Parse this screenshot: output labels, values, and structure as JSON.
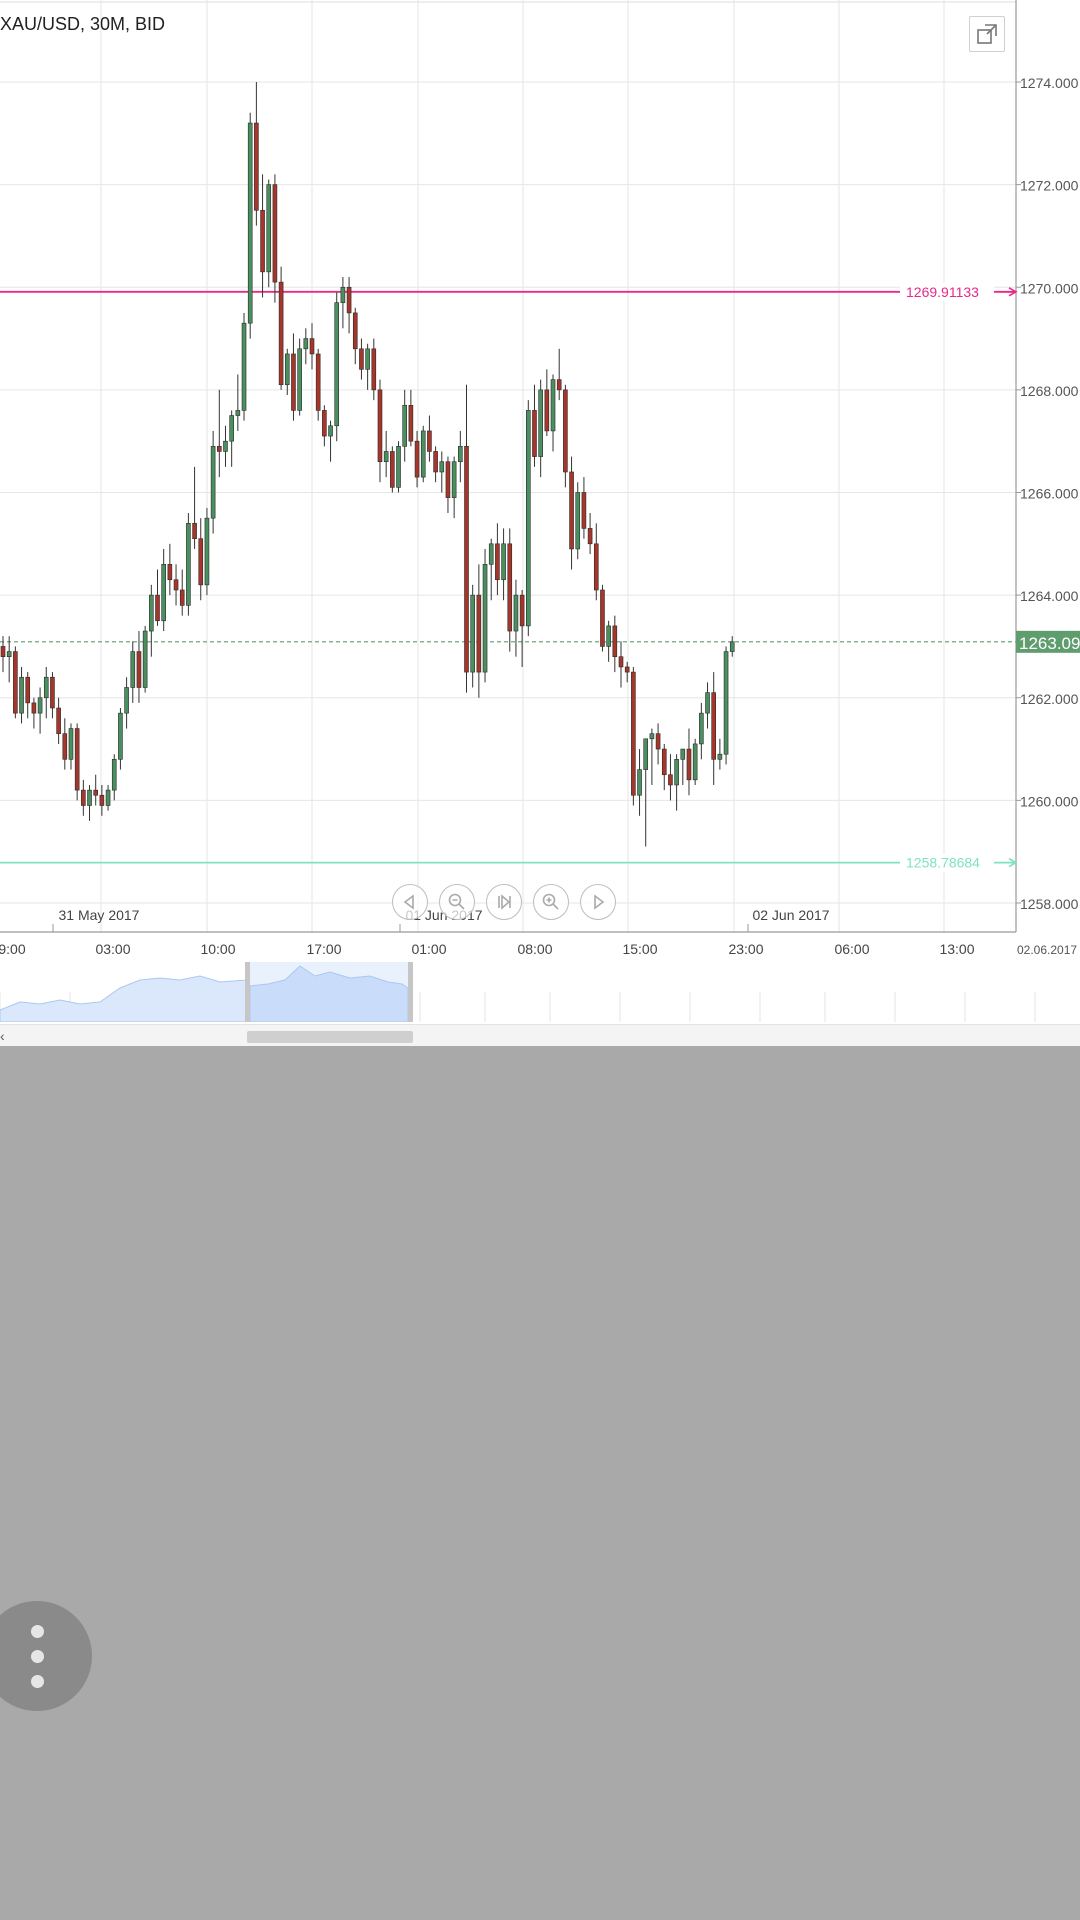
{
  "chart": {
    "title": "XAU/USD, 30M, BID",
    "expand_icon": "expand-icon"
  },
  "nav_controls": [
    {
      "name": "pan-left-button",
      "icon": "triangle-left-icon"
    },
    {
      "name": "zoom-out-button",
      "icon": "zoom-out-icon"
    },
    {
      "name": "go-to-latest-button",
      "icon": "skip-end-icon"
    },
    {
      "name": "zoom-in-button",
      "icon": "zoom-in-icon"
    },
    {
      "name": "pan-right-button",
      "icon": "triangle-right-icon"
    }
  ],
  "fab": {
    "icon": "more-vertical-icon"
  },
  "colors": {
    "bull": "#4a8f5f",
    "bear": "#a6352b",
    "resistance": "#e8298a",
    "support": "#7fe3bd",
    "current_price": "#5f9c6e",
    "grid": "#e6e6e6",
    "navigator_fill": "#dbe8fb",
    "navigator_line": "#aac8f2"
  },
  "chart_data": {
    "type": "candlestick",
    "title": "XAU/USD, 30M, BID",
    "ylim": [
      1257.5,
      1275.2
    ],
    "y_ticks": [
      "1274.000",
      "1272.000",
      "1270.000",
      "1268.000",
      "1266.000",
      "1264.000",
      "1262.000",
      "1260.000",
      "1258.000"
    ],
    "y_tick_values": [
      1274,
      1272,
      1270,
      1268,
      1266,
      1264,
      1262,
      1260,
      1258
    ],
    "x_time_labels": [
      "9:00",
      "03:00",
      "10:00",
      "17:00",
      "01:00",
      "08:00",
      "15:00",
      "23:00",
      "06:00",
      "13:00"
    ],
    "x_date_labels": [
      "31 May 2017",
      "01 Jun 2017",
      "02 Jun 2017"
    ],
    "corner_date": "02.06.2017",
    "resistance_label": "1269.91133",
    "resistance_value": 1269.91133,
    "support_label": "1258.78684",
    "support_value": 1258.78684,
    "current_label": "1263.09",
    "current_value": 1263.09,
    "candles": [
      [
        1263.0,
        1263.2,
        1262.5,
        1262.8
      ],
      [
        1262.8,
        1263.2,
        1262.3,
        1262.9
      ],
      [
        1262.9,
        1263.0,
        1261.6,
        1261.7
      ],
      [
        1261.7,
        1262.6,
        1261.5,
        1262.4
      ],
      [
        1262.4,
        1262.5,
        1261.6,
        1261.9
      ],
      [
        1261.9,
        1262.0,
        1261.4,
        1261.7
      ],
      [
        1261.7,
        1262.2,
        1261.3,
        1262.0
      ],
      [
        1262.0,
        1262.6,
        1261.6,
        1262.4
      ],
      [
        1262.4,
        1262.5,
        1261.6,
        1261.8
      ],
      [
        1261.8,
        1262.0,
        1261.1,
        1261.3
      ],
      [
        1261.3,
        1261.6,
        1260.6,
        1260.8
      ],
      [
        1260.8,
        1261.5,
        1260.6,
        1261.4
      ],
      [
        1261.4,
        1261.5,
        1260.0,
        1260.2
      ],
      [
        1260.2,
        1260.4,
        1259.7,
        1259.9
      ],
      [
        1259.9,
        1260.3,
        1259.6,
        1260.2
      ],
      [
        1260.2,
        1260.5,
        1259.9,
        1260.1
      ],
      [
        1260.1,
        1260.3,
        1259.7,
        1259.9
      ],
      [
        1259.9,
        1260.3,
        1259.8,
        1260.2
      ],
      [
        1260.2,
        1260.9,
        1260.0,
        1260.8
      ],
      [
        1260.8,
        1261.8,
        1260.6,
        1261.7
      ],
      [
        1261.7,
        1262.4,
        1261.4,
        1262.2
      ],
      [
        1262.2,
        1263.1,
        1261.9,
        1262.9
      ],
      [
        1262.9,
        1263.3,
        1261.9,
        1262.2
      ],
      [
        1262.2,
        1263.4,
        1262.1,
        1263.3
      ],
      [
        1263.3,
        1264.2,
        1262.8,
        1264.0
      ],
      [
        1264.0,
        1264.5,
        1263.4,
        1263.5
      ],
      [
        1263.5,
        1264.9,
        1263.3,
        1264.6
      ],
      [
        1264.6,
        1265.0,
        1264.0,
        1264.3
      ],
      [
        1264.3,
        1264.6,
        1263.8,
        1264.1
      ],
      [
        1264.1,
        1264.5,
        1263.6,
        1263.8
      ],
      [
        1263.8,
        1265.6,
        1263.6,
        1265.4
      ],
      [
        1265.4,
        1266.5,
        1264.9,
        1265.1
      ],
      [
        1265.1,
        1265.5,
        1263.9,
        1264.2
      ],
      [
        1264.2,
        1265.7,
        1264.0,
        1265.5
      ],
      [
        1265.5,
        1267.2,
        1265.2,
        1266.9
      ],
      [
        1266.9,
        1268.0,
        1266.3,
        1266.8
      ],
      [
        1266.8,
        1267.3,
        1266.5,
        1267.0
      ],
      [
        1267.0,
        1267.6,
        1266.5,
        1267.5
      ],
      [
        1267.5,
        1268.3,
        1267.2,
        1267.6
      ],
      [
        1267.6,
        1269.5,
        1267.4,
        1269.3
      ],
      [
        1269.3,
        1273.4,
        1269.0,
        1273.2
      ],
      [
        1273.2,
        1274.0,
        1271.2,
        1271.5
      ],
      [
        1271.5,
        1272.2,
        1269.8,
        1270.3
      ],
      [
        1270.3,
        1272.1,
        1270.0,
        1272.0
      ],
      [
        1272.0,
        1272.2,
        1269.7,
        1270.1
      ],
      [
        1270.1,
        1270.4,
        1268.0,
        1268.1
      ],
      [
        1268.1,
        1268.8,
        1267.9,
        1268.7
      ],
      [
        1268.7,
        1269.1,
        1267.4,
        1267.6
      ],
      [
        1267.6,
        1269.0,
        1267.5,
        1268.8
      ],
      [
        1268.8,
        1269.2,
        1268.5,
        1269.0
      ],
      [
        1269.0,
        1269.3,
        1268.4,
        1268.7
      ],
      [
        1268.7,
        1268.8,
        1267.4,
        1267.6
      ],
      [
        1267.6,
        1267.7,
        1266.9,
        1267.1
      ],
      [
        1267.1,
        1267.4,
        1266.6,
        1267.3
      ],
      [
        1267.3,
        1269.9,
        1267.0,
        1269.7
      ],
      [
        1269.7,
        1270.2,
        1269.2,
        1270.0
      ],
      [
        1270.0,
        1270.2,
        1269.1,
        1269.5
      ],
      [
        1269.5,
        1269.6,
        1268.5,
        1268.8
      ],
      [
        1268.8,
        1269.0,
        1268.2,
        1268.4
      ],
      [
        1268.4,
        1268.9,
        1268.0,
        1268.8
      ],
      [
        1268.8,
        1269.0,
        1267.8,
        1268.0
      ],
      [
        1268.0,
        1268.2,
        1266.2,
        1266.6
      ],
      [
        1266.6,
        1267.2,
        1266.3,
        1266.8
      ],
      [
        1266.8,
        1266.9,
        1266.0,
        1266.1
      ],
      [
        1266.1,
        1267.0,
        1266.0,
        1266.9
      ],
      [
        1266.9,
        1268.0,
        1266.6,
        1267.7
      ],
      [
        1267.7,
        1268.0,
        1266.9,
        1267.0
      ],
      [
        1267.0,
        1267.2,
        1266.1,
        1266.3
      ],
      [
        1266.3,
        1267.3,
        1266.2,
        1267.2
      ],
      [
        1267.2,
        1267.5,
        1266.6,
        1266.8
      ],
      [
        1266.8,
        1266.9,
        1266.2,
        1266.4
      ],
      [
        1266.4,
        1266.8,
        1266.0,
        1266.6
      ],
      [
        1266.6,
        1266.7,
        1265.6,
        1265.9
      ],
      [
        1265.9,
        1266.7,
        1265.5,
        1266.6
      ],
      [
        1266.6,
        1267.2,
        1266.2,
        1266.9
      ],
      [
        1266.9,
        1268.1,
        1262.1,
        1262.5
      ],
      [
        1262.5,
        1264.2,
        1262.2,
        1264.0
      ],
      [
        1264.0,
        1264.6,
        1262.0,
        1262.5
      ],
      [
        1262.5,
        1264.9,
        1262.3,
        1264.6
      ],
      [
        1264.6,
        1265.1,
        1263.9,
        1265.0
      ],
      [
        1265.0,
        1265.4,
        1264.0,
        1264.3
      ],
      [
        1264.3,
        1265.3,
        1263.9,
        1265.0
      ],
      [
        1265.0,
        1265.3,
        1262.9,
        1263.3
      ],
      [
        1263.3,
        1264.3,
        1262.8,
        1264.0
      ],
      [
        1264.0,
        1264.1,
        1262.6,
        1263.4
      ],
      [
        1263.4,
        1267.8,
        1263.2,
        1267.6
      ],
      [
        1267.6,
        1268.1,
        1266.5,
        1266.7
      ],
      [
        1266.7,
        1268.2,
        1266.3,
        1268.0
      ],
      [
        1268.0,
        1268.4,
        1267.1,
        1267.2
      ],
      [
        1267.2,
        1268.3,
        1266.8,
        1268.2
      ],
      [
        1268.2,
        1268.8,
        1267.8,
        1268.0
      ],
      [
        1268.0,
        1268.1,
        1266.1,
        1266.4
      ],
      [
        1266.4,
        1266.7,
        1264.5,
        1264.9
      ],
      [
        1264.9,
        1266.2,
        1264.7,
        1266.0
      ],
      [
        1266.0,
        1266.3,
        1265.1,
        1265.3
      ],
      [
        1265.3,
        1265.6,
        1264.8,
        1265.0
      ],
      [
        1265.0,
        1265.4,
        1263.9,
        1264.1
      ],
      [
        1264.1,
        1264.2,
        1262.9,
        1263.0
      ],
      [
        1263.0,
        1263.5,
        1262.7,
        1263.4
      ],
      [
        1263.4,
        1263.6,
        1262.5,
        1262.8
      ],
      [
        1262.8,
        1263.1,
        1262.2,
        1262.6
      ],
      [
        1262.6,
        1262.7,
        1262.3,
        1262.5
      ],
      [
        1262.5,
        1262.6,
        1259.9,
        1260.1
      ],
      [
        1260.1,
        1261.0,
        1259.7,
        1260.6
      ],
      [
        1260.6,
        1260.8,
        1259.1,
        1261.2
      ],
      [
        1261.2,
        1261.4,
        1260.3,
        1261.3
      ],
      [
        1261.3,
        1261.5,
        1260.7,
        1261.0
      ],
      [
        1261.0,
        1261.1,
        1260.2,
        1260.5
      ],
      [
        1260.5,
        1260.9,
        1260.0,
        1260.3
      ],
      [
        1260.3,
        1260.9,
        1259.8,
        1260.8
      ],
      [
        1260.8,
        1261.0,
        1260.3,
        1261.0
      ],
      [
        1261.0,
        1261.4,
        1260.1,
        1260.4
      ],
      [
        1260.4,
        1261.2,
        1260.3,
        1261.1
      ],
      [
        1261.1,
        1261.9,
        1260.8,
        1261.7
      ],
      [
        1261.7,
        1262.3,
        1261.4,
        1262.1
      ],
      [
        1262.1,
        1262.5,
        1260.3,
        1260.8
      ],
      [
        1260.8,
        1261.2,
        1260.6,
        1260.9
      ],
      [
        1260.9,
        1263.0,
        1260.7,
        1262.9
      ],
      [
        1262.9,
        1263.2,
        1262.8,
        1263.09
      ]
    ]
  }
}
